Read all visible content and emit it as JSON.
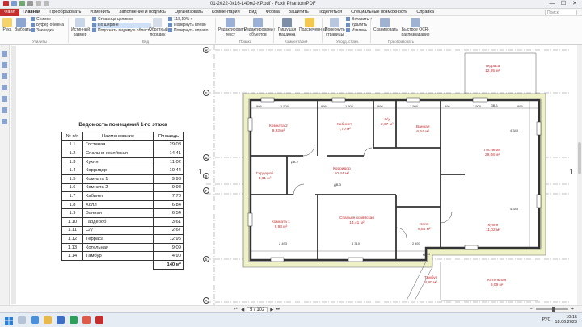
{
  "window": {
    "title": "01-2022-0к16-140м2-КР.pdf - Foxit PhantomPDF",
    "minimize": "—",
    "maximize": "☐",
    "close": "✕"
  },
  "menu": {
    "file": "Файл",
    "tabs": [
      "Главная",
      "Преобразовать",
      "Изменить",
      "Заполнение и подпись",
      "Организовать",
      "Комментарий",
      "Вид",
      "Форма",
      "Защитить",
      "Поделиться",
      "Специальные возможности",
      "Справка"
    ],
    "search_placeholder": "Поиск",
    "right_items": [
      "Найти"
    ]
  },
  "ribbon": {
    "hand": "Рука",
    "select": "Выбрать",
    "utilities": [
      "Снимок",
      "Буфер обмена",
      "Закладка"
    ],
    "utilities_group": "Утилиты",
    "actual_size": "Истинный размер",
    "view_opts": [
      "Страница целиком",
      "По ширине",
      "Подогнать видимую область"
    ],
    "reverse_order": "Обратный порядок",
    "zoom_value": "118,19%",
    "rotate": [
      "Повернуть влево",
      "Повернуть вправо"
    ],
    "view_group": "Вид",
    "edit_text": "Редактировать текст",
    "edit_objects": "Редактирование объектов",
    "edit_group": "Правка",
    "typewriter": "Пишущая машинка",
    "highlight": "Подсвеченный",
    "comment_group": "Комментарий",
    "rotate_pages": "Повернуть страницы",
    "page_ops": [
      "Вставить",
      "Удалить",
      "Извлечь"
    ],
    "pages_group": "Упорд. стран.",
    "scan": "Сканировать",
    "ocr": "Быстрое OCR-распознавание",
    "convert_group": "Преобразовать"
  },
  "document": {
    "table_title": "Ведомость помещений 1-го этажа",
    "columns": [
      "№ п/п",
      "Наименование",
      "Площадь"
    ],
    "rows": [
      [
        "1.1",
        "Гостиная",
        "29,08"
      ],
      [
        "1.2",
        "Спальня хозяйская",
        "14,41"
      ],
      [
        "1.3",
        "Кухня",
        "11,02"
      ],
      [
        "1.4",
        "Корридор",
        "10,44"
      ],
      [
        "1.5",
        "Комната 1",
        "9,93"
      ],
      [
        "1.6",
        "Комната 2",
        "9,93"
      ],
      [
        "1.7",
        "Кабинет",
        "7,70"
      ],
      [
        "1.8",
        "Холл",
        "6,84"
      ],
      [
        "1.9",
        "Ванная",
        "6,54"
      ],
      [
        "1.10",
        "Гардероб",
        "3,61"
      ],
      [
        "1.11",
        "С/у",
        "2,67"
      ],
      [
        "1.12",
        "Терраса",
        "12,95"
      ],
      [
        "1.13",
        "Котельная",
        "9,09"
      ],
      [
        "1.14",
        "Тамбур",
        "4,90"
      ]
    ],
    "total": "140  м²",
    "axes_rows": [
      "Ж",
      "Е",
      "Д",
      "В",
      "Г",
      "Б",
      "А"
    ],
    "side_marks": [
      "1",
      "1"
    ],
    "rooms": [
      {
        "name": "Комната 2",
        "area": "9,93 м²"
      },
      {
        "name": "Кабинет",
        "area": "7,70 м²"
      },
      {
        "name": "С/у",
        "area": "2,67 м²"
      },
      {
        "name": "Ванная",
        "area": "6,54 м²"
      },
      {
        "name": "Терраса",
        "area": "12,95 м²"
      },
      {
        "name": "Гостиная",
        "area": "29,08 м²"
      },
      {
        "name": "Гардероб",
        "area": "3,61 м²"
      },
      {
        "name": "Корридор",
        "area": "10,44 м²"
      },
      {
        "name": "Комната 1",
        "area": "9,93 м²"
      },
      {
        "name": "Спальня хозяйская",
        "area": "14,41 м²"
      },
      {
        "name": "Холл",
        "area": "6,84 м²"
      },
      {
        "name": "Кухня",
        "area": "11,02 м²"
      },
      {
        "name": "Тамбур",
        "area": "4,90 м²"
      },
      {
        "name": "Котельная",
        "area": "9,09 м²"
      }
    ],
    "dims_top": [
      "996",
      "1 500",
      "996",
      "1 500",
      "996",
      "1 500",
      "996",
      "1 500",
      "996"
    ],
    "dims_right": [
      "4 343",
      "4 343"
    ],
    "dims_bottom": [
      "2 493",
      "4 310",
      "2 493"
    ],
    "door_tags": [
      "ДВ-1",
      "ДВ-2",
      "ДВ-3",
      "ДВ-4"
    ]
  },
  "status": {
    "page": "5 / 102",
    "zoom_pct": "118,19%"
  },
  "taskbar": {
    "lang": "РУС",
    "time": "10:15",
    "date": "18.06.2023"
  }
}
